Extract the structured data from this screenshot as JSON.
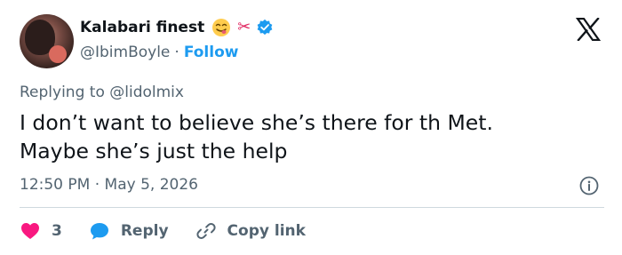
{
  "author": {
    "display_name": "Kalabari finest",
    "handle": "@IbimBoyle",
    "follow_label": "Follow",
    "separator": "·"
  },
  "colors": {
    "accent": "#1d9bf0",
    "like": "#f91880",
    "text": "#0f1419",
    "muted": "#536471"
  },
  "icons": {
    "emoji": "face-savoring-food-icon",
    "decoration": "scissors-icon",
    "badge": "verified-badge-icon",
    "platform": "x-logo-icon",
    "info": "info-icon",
    "like": "heart-icon",
    "reply": "speech-bubble-icon",
    "copy": "link-icon"
  },
  "tweet": {
    "reply_to_prefix": "Replying to",
    "reply_to_handle": "@lidolmix",
    "text_line1": "I don’t want to believe she’s there for th Met.",
    "text_line2": "Maybe she’s just the help",
    "time": "12:50 PM",
    "meta_separator": "·",
    "date": "May 5, 2026"
  },
  "actions": {
    "like_count": "3",
    "reply_label": "Reply",
    "copy_label": "Copy link"
  }
}
